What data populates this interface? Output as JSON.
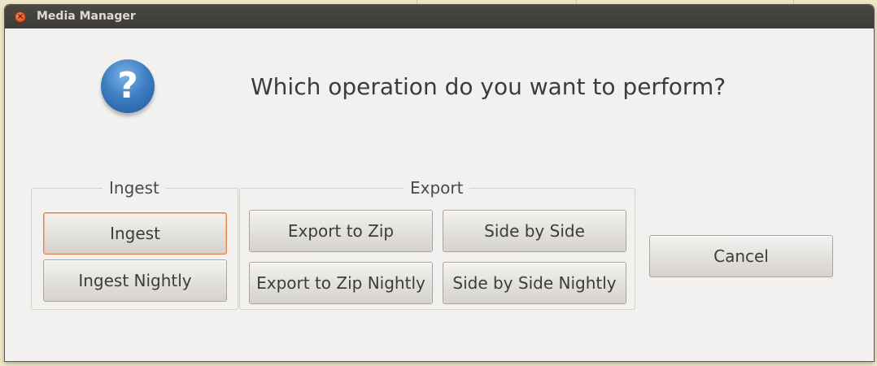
{
  "window": {
    "title": "Media Manager"
  },
  "dialog": {
    "icon": "question-icon",
    "question": "Which operation do you want to perform?"
  },
  "ingest_group": {
    "label": "Ingest",
    "buttons": [
      "Ingest",
      "Ingest Nightly"
    ]
  },
  "export_group": {
    "label": "Export",
    "buttons": [
      "Export to Zip",
      "Side by Side",
      "Export to Zip Nightly",
      "Side by Side Nightly"
    ]
  },
  "cancel_label": "Cancel",
  "colors": {
    "focus_accent": "#e3834d",
    "titlebar": "#3c3b37",
    "close_button": "#df4b16",
    "icon_blue": "#3e7fc3"
  }
}
